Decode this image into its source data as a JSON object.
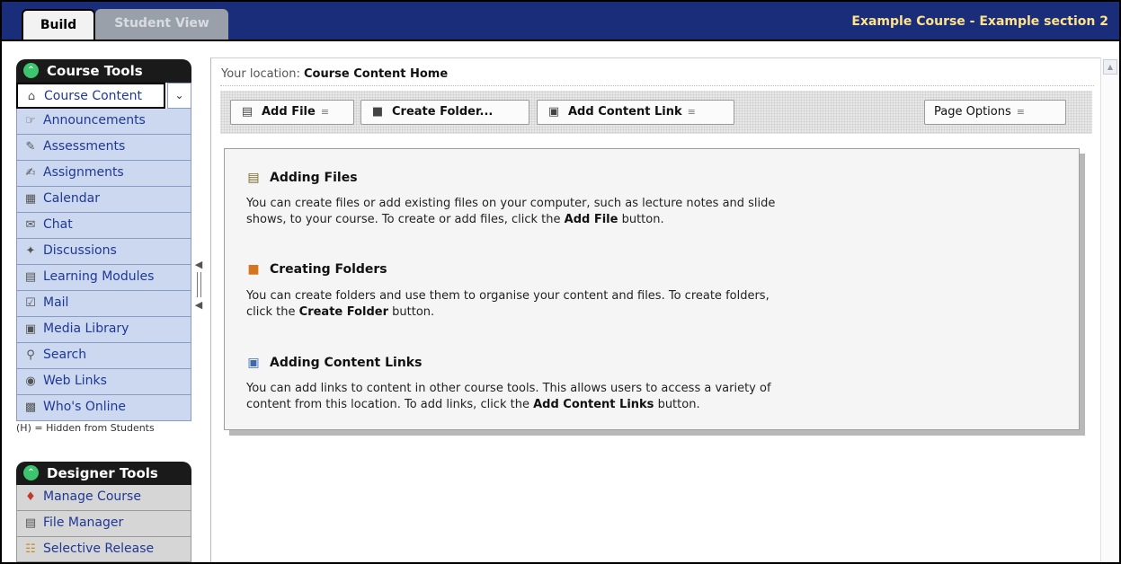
{
  "tabs": {
    "build": "Build",
    "student_view": "Student View"
  },
  "course_title": "Example Course - Example section 2",
  "course_tools": {
    "heading": "Course Tools",
    "items": [
      {
        "label": "Course Content",
        "icon": "home-icon"
      },
      {
        "label": "Announcements",
        "icon": "megaphone-icon"
      },
      {
        "label": "Assessments",
        "icon": "assessment-icon"
      },
      {
        "label": "Assignments",
        "icon": "assignment-icon"
      },
      {
        "label": "Calendar",
        "icon": "calendar-icon"
      },
      {
        "label": "Chat",
        "icon": "chat-icon"
      },
      {
        "label": "Discussions",
        "icon": "discussion-icon"
      },
      {
        "label": "Learning Modules",
        "icon": "module-icon"
      },
      {
        "label": "Mail",
        "icon": "mail-icon"
      },
      {
        "label": "Media Library",
        "icon": "media-library-icon"
      },
      {
        "label": "Search",
        "icon": "search-icon"
      },
      {
        "label": "Web Links",
        "icon": "globe-icon"
      },
      {
        "label": "Who's Online",
        "icon": "user-icon"
      }
    ],
    "hidden_note": "(H) = Hidden from Students"
  },
  "designer_tools": {
    "heading": "Designer Tools",
    "items": [
      {
        "label": "Manage Course",
        "icon": "manage-course-icon"
      },
      {
        "label": "File Manager",
        "icon": "file-manager-icon"
      },
      {
        "label": "Selective Release",
        "icon": "selective-release-icon"
      }
    ]
  },
  "location": {
    "prefix": "Your location:",
    "value": "Course Content Home"
  },
  "toolbar": {
    "add_file": "Add File",
    "create_folder": "Create Folder...",
    "add_content_link": "Add Content Link",
    "page_options": "Page Options"
  },
  "info": [
    {
      "title": "Adding Files",
      "line1": "You can create files or add existing files on your computer, such as lecture notes and slide",
      "line2a": "shows, to your course. To create or add files, click the ",
      "bold": "Add File",
      "line2b": " button."
    },
    {
      "title": "Creating Folders",
      "line1": "You can create folders and use them to organise your content and files. To create folders,",
      "line2a": "click the ",
      "bold": "Create Folder",
      "line2b": " button."
    },
    {
      "title": "Adding Content Links",
      "line1": "You can add links to content in other course tools. This allows users to access a variety of",
      "line2a": "content from this location. To add links, click the ",
      "bold": "Add Content Links",
      "line2b": " button."
    }
  ],
  "colors": {
    "header_bg": "#1a2d7a",
    "course_title": "#ffe38a",
    "menu_bg": "#cbd8ef",
    "menu_text": "#1f3896",
    "panel_head_bg": "#1a1a1a"
  }
}
